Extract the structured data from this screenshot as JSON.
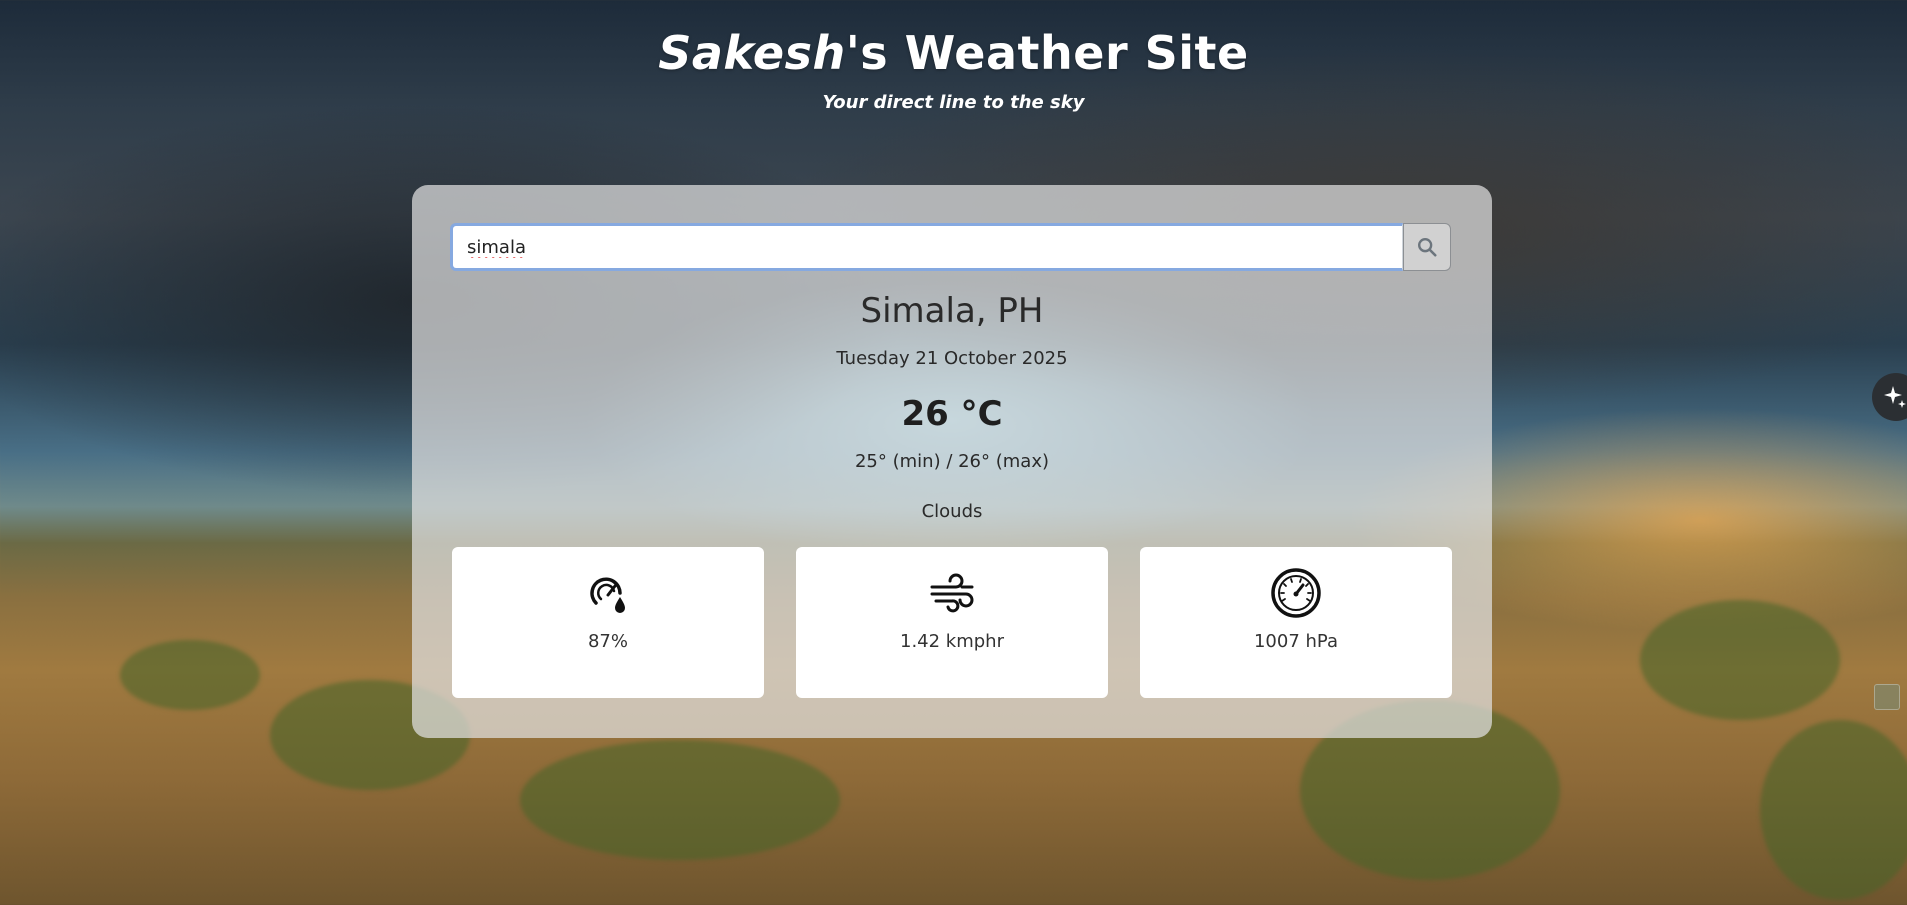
{
  "header": {
    "title_name": "Sakesh",
    "title_rest": "'s Weather Site",
    "tagline": "Your direct line to the sky"
  },
  "search": {
    "value": "simala",
    "button_icon": "search-icon"
  },
  "weather": {
    "city": "Simala, PH",
    "date": "Tuesday 21 October 2025",
    "temperature": "26 °C",
    "min_max": "25° (min) / 26° (max)",
    "condition": "Clouds"
  },
  "stats": {
    "humidity": {
      "icon": "humidity-gauge-icon",
      "value": "87%"
    },
    "wind": {
      "icon": "wind-icon",
      "value": "1.42 kmphr"
    },
    "pressure": {
      "icon": "barometer-icon",
      "value": "1007 hPa"
    }
  },
  "colors": {
    "card_background": "#e1e1e1",
    "input_focus_border": "#86a9e0",
    "stat_card_background": "#ffffff"
  }
}
